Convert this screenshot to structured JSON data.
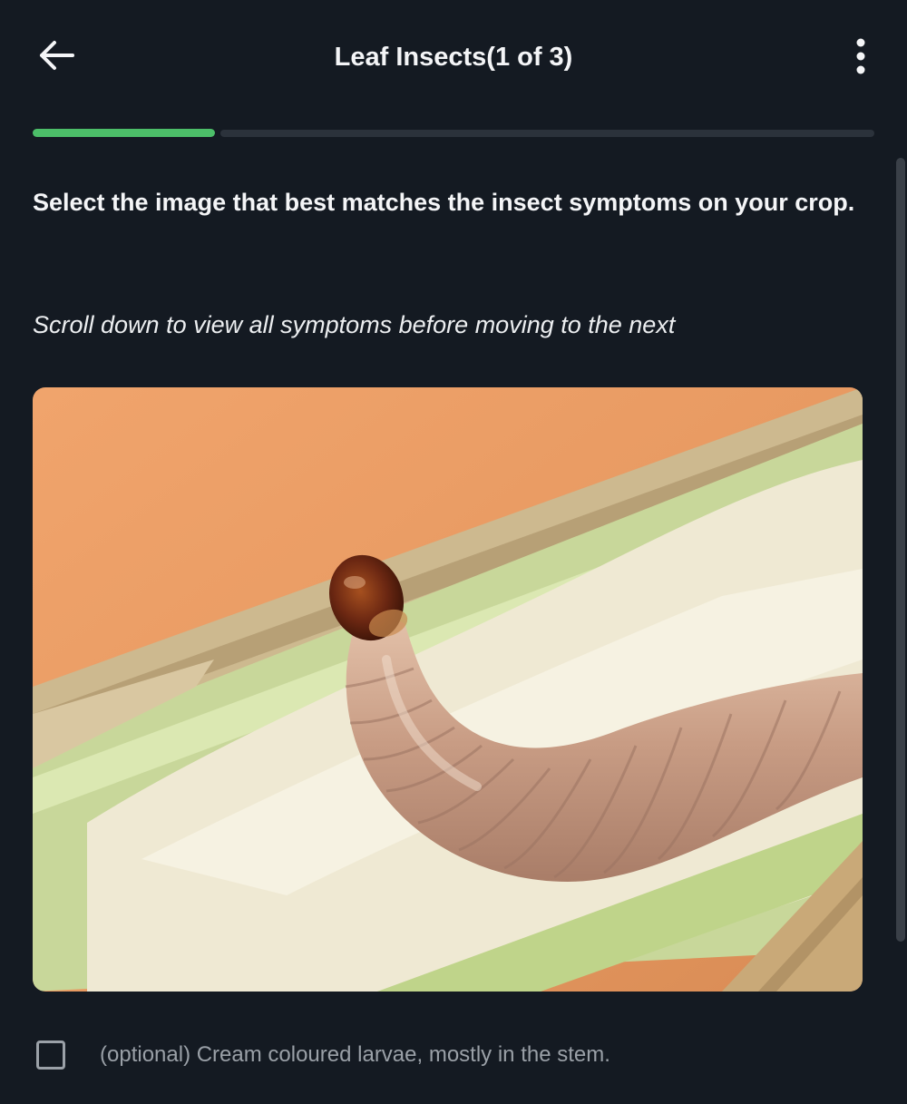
{
  "header": {
    "title": "Leaf Insects(1 of 3)",
    "back_icon": "arrow-left-icon",
    "menu_icon": "more-vertical-icon"
  },
  "progress": {
    "current": 1,
    "total": 3,
    "fraction": 0.2167
  },
  "instruction": "Select the image that best matches the insect symptoms on your crop.",
  "hint": "Scroll down to view all symptoms before moving to the next",
  "symptom_option": {
    "label": "(optional) Cream coloured larvae, mostly in the stem.",
    "checked": false
  },
  "colors": {
    "background": "#141a22",
    "accent_green": "#4cbe69",
    "track": "#2b323b",
    "text_primary": "#f4f5f7",
    "text_muted": "#9aa0a7"
  }
}
